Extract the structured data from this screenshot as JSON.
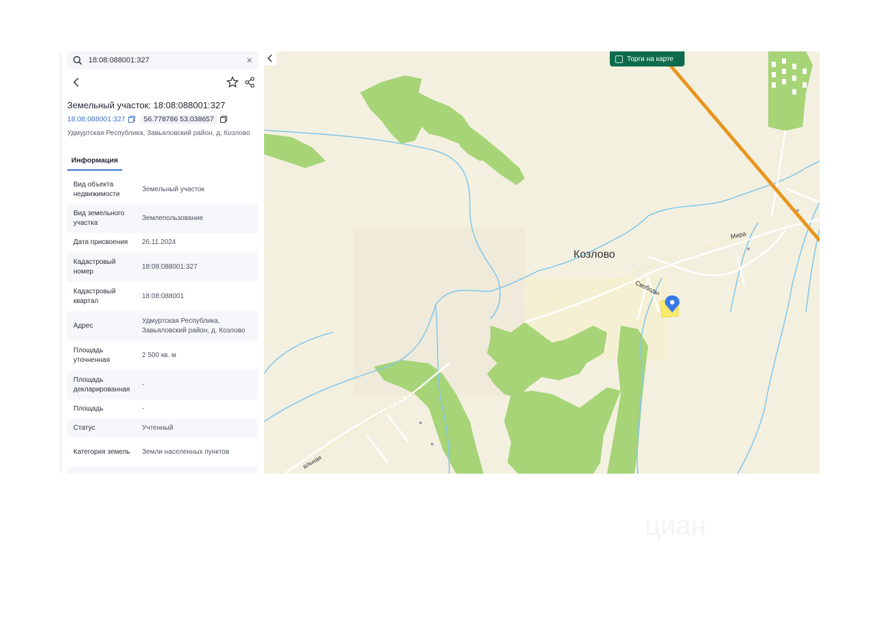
{
  "search": {
    "value": "18:08:088001:327"
  },
  "header": {
    "title": "Земельный участок: 18:08:088001:327",
    "cadastral_link": "18:08:088001:327",
    "coordinates": "56.778786 53.038657",
    "address": "Удмуртская Республика, Завьяловский район, д. Козлово"
  },
  "tabs": [
    {
      "label": "Информация",
      "active": true
    }
  ],
  "info": [
    {
      "key": "Вид объекта недвижимости",
      "value": "Земельный участок"
    },
    {
      "key": "Вид земельного участка",
      "value": "Землепользование"
    },
    {
      "key": "Дата присвоения",
      "value": "26.11.2024"
    },
    {
      "key": "Кадастровый номер",
      "value": "18:08:088001:327"
    },
    {
      "key": "Кадастровый квартал",
      "value": "18:08:088001"
    },
    {
      "key": "Адрес",
      "value": "Удмуртская Республика, Завьяловский район, д. Козлово"
    },
    {
      "key": "Площадь уточненная",
      "value": "2 500 кв. м"
    },
    {
      "key": "Площадь декларированная",
      "value": "-"
    },
    {
      "key": "Площадь",
      "value": "-"
    },
    {
      "key": "Статус",
      "value": "Учтенный"
    },
    {
      "key": "Категория земель",
      "value": "Земли населенных пунктов"
    }
  ],
  "map": {
    "torgi_label": "Торги на карте",
    "village_label": "Козлово",
    "street_mira": "Мира",
    "street_svobody": "Свободы",
    "street_partial": "альная"
  },
  "watermark": "циан",
  "colors": {
    "accent": "#3a72c4",
    "torgi_bg": "#0f6b4e",
    "forest": "#a9d57a",
    "water": "#7ec3e6",
    "rail": "#e8951e"
  }
}
